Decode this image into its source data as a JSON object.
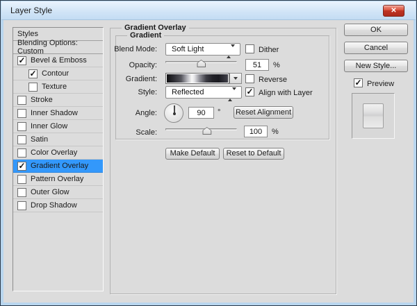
{
  "window": {
    "title": "Layer Style",
    "close_glyph": "✕"
  },
  "styles_panel": {
    "items": [
      {
        "label": "Styles",
        "type": "header"
      },
      {
        "label": "Blending Options: Custom",
        "type": "header"
      },
      {
        "label": "Bevel & Emboss",
        "checked": true
      },
      {
        "label": "Contour",
        "checked": true,
        "indent": true
      },
      {
        "label": "Texture",
        "checked": false,
        "indent": true
      },
      {
        "label": "Stroke",
        "checked": false
      },
      {
        "label": "Inner Shadow",
        "checked": false
      },
      {
        "label": "Inner Glow",
        "checked": false
      },
      {
        "label": "Satin",
        "checked": false
      },
      {
        "label": "Color Overlay",
        "checked": false
      },
      {
        "label": "Gradient Overlay",
        "checked": true,
        "selected": true
      },
      {
        "label": "Pattern Overlay",
        "checked": false
      },
      {
        "label": "Outer Glow",
        "checked": false
      },
      {
        "label": "Drop Shadow",
        "checked": false
      }
    ]
  },
  "main": {
    "group_title": "Gradient Overlay",
    "inner_group_title": "Gradient",
    "blend_mode": {
      "label": "Blend Mode:",
      "value": "Soft Light"
    },
    "dither": {
      "label": "Dither",
      "check": ""
    },
    "opacity": {
      "label": "Opacity:",
      "value": "51",
      "unit": "%",
      "thumb_left": "50%"
    },
    "gradient": {
      "label": "Gradient:",
      "reverse_label": "Reverse",
      "reverse_check": ""
    },
    "style": {
      "label": "Style:",
      "value": "Reflected",
      "align_label": "Align with Layer",
      "align_check": "✓"
    },
    "angle": {
      "label": "Angle:",
      "value": "90",
      "unit": "°",
      "reset_button": "Reset Alignment"
    },
    "scale": {
      "label": "Scale:",
      "value": "100",
      "unit": "%",
      "thumb_left": "58%"
    },
    "buttons": {
      "make_default": "Make Default",
      "reset_default": "Reset to Default"
    }
  },
  "actions": {
    "ok": "OK",
    "cancel": "Cancel",
    "new_style": "New Style...",
    "preview": {
      "label": "Preview",
      "check": "✓"
    }
  },
  "colors": {
    "selection": "#3398fb",
    "titlebar_top": "#eaf4fd",
    "close_red": "#c03524"
  },
  "visuals": {
    "gradient_preview_css": "linear-gradient(90deg, #0d0d0f 0%, #2e2e33 12%, #55555c 24%, #b9b9bf 34%, #f8f8f8 41%, #e6e6e9 45%, #8a8a92 54%, #3c3c44 64%, #232329 74%, #1b1b21 84%, #34343c 94%, #44444c 100%)",
    "style_preview_css": "linear-gradient(#f1f1f1, #e3e3e3 30%, #d0d0d2 48%, #dedede 55%, #ebebeb)"
  }
}
